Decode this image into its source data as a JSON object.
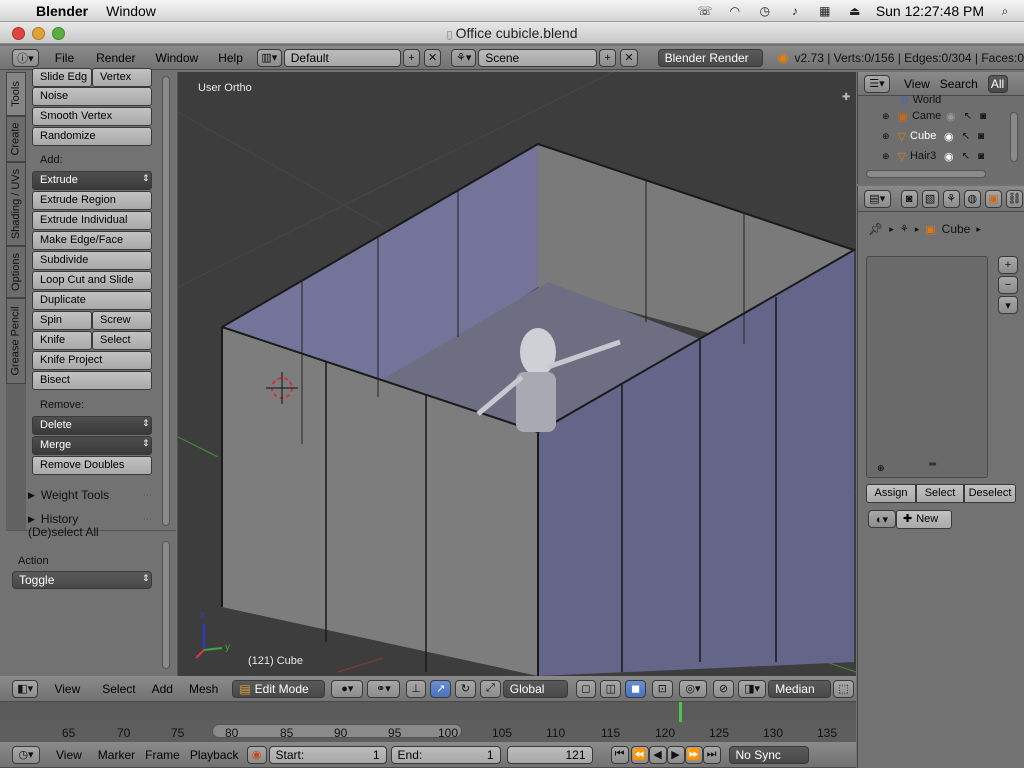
{
  "os_menu": {
    "app": "Blender",
    "items": [
      "Window"
    ],
    "clock": "Sun 12:27:48 PM"
  },
  "window": {
    "title": "Office cubicle.blend"
  },
  "info_header": {
    "menus": [
      "File",
      "Render",
      "Window",
      "Help"
    ],
    "screen": "Default",
    "scene": "Scene",
    "engine": "Blender Render",
    "stats": "v2.73 | Verts:0/156 | Edges:0/304 | Faces:0"
  },
  "tool_tabs": [
    "Tools",
    "Create",
    "Shading / UVs",
    "Options",
    "Grease Pencil"
  ],
  "tools": {
    "top_row": [
      "Slide Edg",
      "Vertex"
    ],
    "list1": [
      "Noise",
      "Smooth Vertex",
      "Randomize"
    ],
    "add_label": "Add:",
    "extrude": "Extrude",
    "list2": [
      "Extrude Region",
      "Extrude Individual",
      "Make Edge/Face",
      "Subdivide",
      "Loop Cut and Slide",
      "Duplicate"
    ],
    "spin": "Spin",
    "screw": "Screw",
    "knife": "Knife",
    "select": "Select",
    "list3": [
      "Knife Project",
      "Bisect"
    ],
    "remove_label": "Remove:",
    "delete": "Delete",
    "merge": "Merge",
    "remove_doubles": "Remove Doubles",
    "weight_tools": "Weight Tools",
    "history": "History",
    "deselect_all": "(De)select All",
    "action_label": "Action",
    "action_value": "Toggle"
  },
  "viewport": {
    "view_name": "User Ortho",
    "object_info": "(121) Cube"
  },
  "outliner": {
    "menus": [
      "View",
      "Search",
      "All"
    ],
    "rows": [
      "World",
      "Came",
      "Cube",
      "Hair3"
    ]
  },
  "properties": {
    "breadcrumb": "Cube",
    "buttons": [
      "Assign",
      "Select",
      "Deselect"
    ],
    "new_button": "New"
  },
  "view3d_header": {
    "menus": [
      "View",
      "Select",
      "Add",
      "Mesh"
    ],
    "mode": "Edit Mode",
    "orientation": "Global",
    "pivot": "Median"
  },
  "timeline": {
    "ticks": [
      "65",
      "70",
      "75",
      "80",
      "85",
      "90",
      "95",
      "100",
      "105",
      "110",
      "115",
      "120",
      "125",
      "130",
      "135"
    ],
    "current_frame_marker": 121
  },
  "timeline_header": {
    "menus": [
      "View",
      "Marker",
      "Frame",
      "Playback"
    ],
    "start_label": "Start:",
    "start": "1",
    "end_label": "End:",
    "end": "1",
    "current": "121",
    "sync": "No Sync"
  }
}
